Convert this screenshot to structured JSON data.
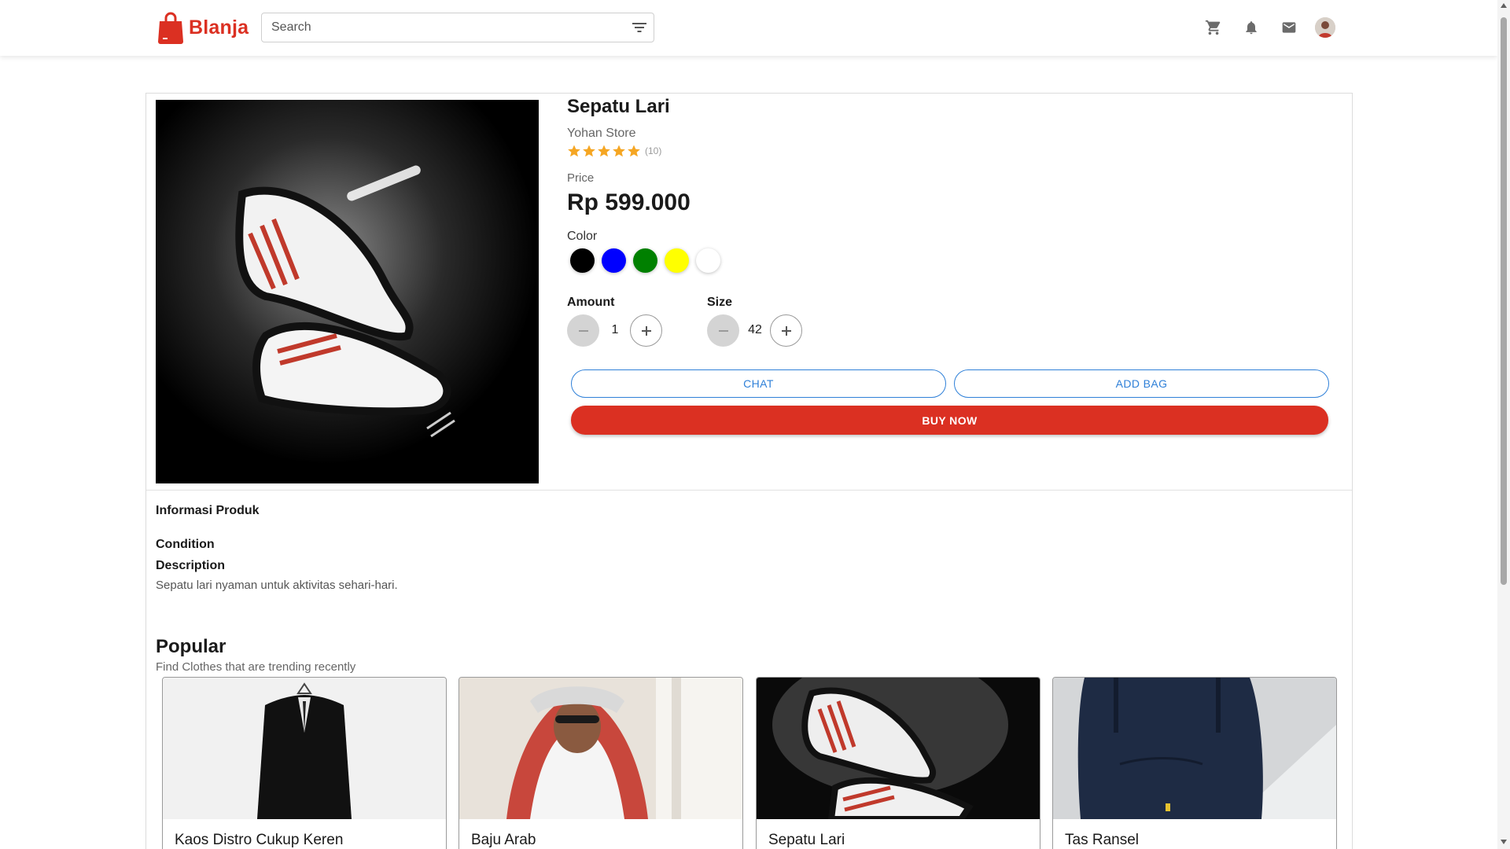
{
  "header": {
    "brand": "Blanja",
    "search_placeholder": "Search",
    "icons": [
      "cart-icon",
      "bell-icon",
      "mail-icon",
      "avatar"
    ]
  },
  "product": {
    "title": "Sepatu Lari",
    "store": "Yohan Store",
    "rating": 5,
    "rating_count": "(10)",
    "price_label": "Price",
    "price": "Rp 599.000",
    "color_label": "Color",
    "colors": [
      "#000000",
      "#0000ff",
      "#008000",
      "#ffff00",
      "#ffffff"
    ],
    "amount_label": "Amount",
    "amount": "1",
    "size_label": "Size",
    "size": "42",
    "chat_label": "CHAT",
    "add_bag_label": "ADD BAG",
    "buy_label": "BUY NOW"
  },
  "info": {
    "title": "Informasi Produk",
    "condition_label": "Condition",
    "description_label": "Description",
    "description": "Sepatu lari nyaman untuk aktivitas sehari-hari."
  },
  "popular": {
    "title": "Popular",
    "subtitle": "Find Clothes that are trending recently",
    "items": [
      {
        "name": "Kaos Distro Cukup Keren"
      },
      {
        "name": "Baju Arab"
      },
      {
        "name": "Sepatu Lari"
      },
      {
        "name": "Tas Ransel"
      }
    ]
  },
  "colors": {
    "brand": "#db3022",
    "accent": "#2f80d8",
    "star": "#f5a623"
  }
}
